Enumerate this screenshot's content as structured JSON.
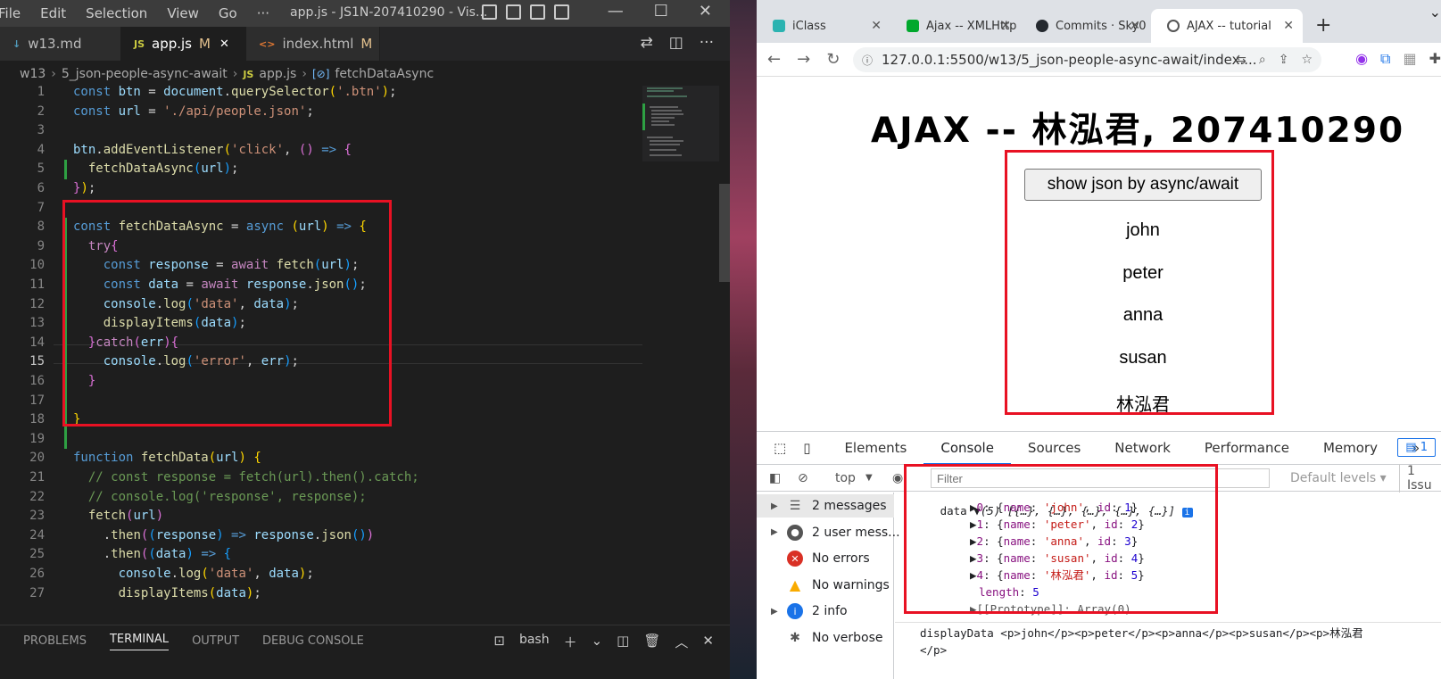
{
  "vscode": {
    "menu": [
      "File",
      "Edit",
      "Selection",
      "View",
      "Go",
      "···"
    ],
    "window_title": "app.js - JS1N-207410290 - Vis...",
    "tabs": [
      {
        "icon": "",
        "label": "w13.md"
      },
      {
        "icon": "JS",
        "label": "app.js",
        "mod": "M"
      },
      {
        "icon": "<>",
        "label": "index.html",
        "mod": "M"
      }
    ],
    "breadcrumb": [
      "w13",
      "5_json-people-async-await",
      "app.js",
      "fetchDataAsync"
    ],
    "panel_tabs": [
      "PROBLEMS",
      "TERMINAL",
      "OUTPUT",
      "DEBUG CONSOLE"
    ],
    "terminal_shell": "bash",
    "current_line": 15
  },
  "code": [
    [
      [
        "kw",
        "const "
      ],
      [
        "var",
        "btn"
      ],
      [
        "pl",
        " = "
      ],
      [
        "var",
        "document"
      ],
      [
        "pl",
        "."
      ],
      [
        "fn",
        "querySelector"
      ],
      [
        "br1",
        "("
      ],
      [
        "str",
        "'.btn'"
      ],
      [
        "br1",
        ")"
      ],
      [
        "pl",
        ";"
      ]
    ],
    [
      [
        "kw",
        "const "
      ],
      [
        "var",
        "url"
      ],
      [
        "pl",
        " = "
      ],
      [
        "str",
        "'./api/people.json'"
      ],
      [
        "pl",
        ";"
      ]
    ],
    [],
    [
      [
        "var",
        "btn"
      ],
      [
        "pl",
        "."
      ],
      [
        "fn",
        "addEventListener"
      ],
      [
        "br1",
        "("
      ],
      [
        "str",
        "'click'"
      ],
      [
        "pl",
        ", "
      ],
      [
        "br2",
        "()"
      ],
      [
        "kw",
        " => "
      ],
      [
        "br2",
        "{"
      ]
    ],
    [
      [
        "pl",
        "  "
      ],
      [
        "fn",
        "fetchDataAsync"
      ],
      [
        "br3",
        "("
      ],
      [
        "var",
        "url"
      ],
      [
        "br3",
        ")"
      ],
      [
        "pl",
        ";"
      ]
    ],
    [
      [
        "br2",
        "}"
      ],
      [
        "br1",
        ")"
      ],
      [
        "pl",
        ";"
      ]
    ],
    [],
    [
      [
        "kw",
        "const "
      ],
      [
        "fn",
        "fetchDataAsync"
      ],
      [
        "pl",
        " = "
      ],
      [
        "kw",
        "async "
      ],
      [
        "br1",
        "("
      ],
      [
        "var",
        "url"
      ],
      [
        "br1",
        ")"
      ],
      [
        "kw",
        " => "
      ],
      [
        "br1",
        "{"
      ]
    ],
    [
      [
        "pl",
        "  "
      ],
      [
        "ctl",
        "try"
      ],
      [
        "br2",
        "{"
      ]
    ],
    [
      [
        "pl",
        "    "
      ],
      [
        "kw",
        "const "
      ],
      [
        "var",
        "response"
      ],
      [
        "pl",
        " = "
      ],
      [
        "ctl",
        "await "
      ],
      [
        "fn",
        "fetch"
      ],
      [
        "br3",
        "("
      ],
      [
        "var",
        "url"
      ],
      [
        "br3",
        ")"
      ],
      [
        "pl",
        ";"
      ]
    ],
    [
      [
        "pl",
        "    "
      ],
      [
        "kw",
        "const "
      ],
      [
        "var",
        "data"
      ],
      [
        "pl",
        " = "
      ],
      [
        "ctl",
        "await "
      ],
      [
        "var",
        "response"
      ],
      [
        "pl",
        "."
      ],
      [
        "fn",
        "json"
      ],
      [
        "br3",
        "()"
      ],
      [
        "pl",
        ";"
      ]
    ],
    [
      [
        "pl",
        "    "
      ],
      [
        "var",
        "console"
      ],
      [
        "pl",
        "."
      ],
      [
        "fn",
        "log"
      ],
      [
        "br3",
        "("
      ],
      [
        "str",
        "'data'"
      ],
      [
        "pl",
        ", "
      ],
      [
        "var",
        "data"
      ],
      [
        "br3",
        ")"
      ],
      [
        "pl",
        ";"
      ]
    ],
    [
      [
        "pl",
        "    "
      ],
      [
        "fn",
        "displayItems"
      ],
      [
        "br3",
        "("
      ],
      [
        "var",
        "data"
      ],
      [
        "br3",
        ")"
      ],
      [
        "pl",
        ";"
      ]
    ],
    [
      [
        "pl",
        "  "
      ],
      [
        "br2",
        "}"
      ],
      [
        "ctl",
        "catch"
      ],
      [
        "br2",
        "("
      ],
      [
        "var",
        "err"
      ],
      [
        "br2",
        ")"
      ],
      [
        "br2",
        "{"
      ]
    ],
    [
      [
        "pl",
        "    "
      ],
      [
        "var",
        "console"
      ],
      [
        "pl",
        "."
      ],
      [
        "fn",
        "log"
      ],
      [
        "br3",
        "("
      ],
      [
        "str",
        "'error'"
      ],
      [
        "pl",
        ", "
      ],
      [
        "var",
        "err"
      ],
      [
        "br3",
        ")"
      ],
      [
        "pl",
        ";"
      ]
    ],
    [
      [
        "pl",
        "  "
      ],
      [
        "br2",
        "}"
      ]
    ],
    [],
    [
      [
        "br1",
        "}"
      ]
    ],
    [],
    [
      [
        "kw",
        "function "
      ],
      [
        "fn",
        "fetchData"
      ],
      [
        "br1",
        "("
      ],
      [
        "var",
        "url"
      ],
      [
        "br1",
        ")"
      ],
      [
        "pl",
        " "
      ],
      [
        "br1",
        "{"
      ]
    ],
    [
      [
        "cm",
        "  // const response = fetch(url).then().catch;"
      ]
    ],
    [
      [
        "cm",
        "  // console.log('response', response);"
      ]
    ],
    [
      [
        "pl",
        "  "
      ],
      [
        "fn",
        "fetch"
      ],
      [
        "br2",
        "("
      ],
      [
        "var",
        "url"
      ],
      [
        "br2",
        ")"
      ]
    ],
    [
      [
        "pl",
        "    ."
      ],
      [
        "fn",
        "then"
      ],
      [
        "br2",
        "("
      ],
      [
        "br3",
        "("
      ],
      [
        "var",
        "response"
      ],
      [
        "br3",
        ")"
      ],
      [
        "kw",
        " => "
      ],
      [
        "var",
        "response"
      ],
      [
        "pl",
        "."
      ],
      [
        "fn",
        "json"
      ],
      [
        "br3",
        "()"
      ],
      [
        "br2",
        ")"
      ]
    ],
    [
      [
        "pl",
        "    ."
      ],
      [
        "fn",
        "then"
      ],
      [
        "br2",
        "("
      ],
      [
        "br3",
        "("
      ],
      [
        "var",
        "data"
      ],
      [
        "br3",
        ")"
      ],
      [
        "kw",
        " => "
      ],
      [
        "br3",
        "{"
      ]
    ],
    [
      [
        "pl",
        "      "
      ],
      [
        "var",
        "console"
      ],
      [
        "pl",
        "."
      ],
      [
        "fn",
        "log"
      ],
      [
        "br1",
        "("
      ],
      [
        "str",
        "'data'"
      ],
      [
        "pl",
        ", "
      ],
      [
        "var",
        "data"
      ],
      [
        "br1",
        ")"
      ],
      [
        "pl",
        ";"
      ]
    ],
    [
      [
        "pl",
        "      "
      ],
      [
        "fn",
        "displayItems"
      ],
      [
        "br1",
        "("
      ],
      [
        "var",
        "data"
      ],
      [
        "br1",
        ")"
      ],
      [
        "pl",
        ";"
      ]
    ],
    [
      [
        "pl",
        "    "
      ],
      [
        "br3",
        "}"
      ],
      [
        "br2",
        ")"
      ]
    ]
  ],
  "chrome": {
    "tabs": [
      "iClass",
      "Ajax -- XMLHttp",
      "Commits · Sky0",
      "AJAX -- tutorial"
    ],
    "url": "127.0.0.1:5500/w13/5_json-people-async-await/index....",
    "page_title": "AJAX -- 林泓君, 207410290",
    "button": "show json by async/await",
    "people": [
      "john",
      "peter",
      "anna",
      "susan",
      "林泓君"
    ]
  },
  "devtools": {
    "tabs": [
      "Elements",
      "Console",
      "Sources",
      "Network",
      "Performance",
      "Memory"
    ],
    "active_tab": "Console",
    "issues_count": "1",
    "context": "top",
    "filter_placeholder": "Filter",
    "levels": "Default levels ▾",
    "issues_label": "1 Issu",
    "sidebar": [
      {
        "label": "2 messages",
        "icon": "list-icon",
        "color": "#555"
      },
      {
        "label": "2 user mess...",
        "icon": "user-icon",
        "color": "#555"
      },
      {
        "label": "No errors",
        "icon": "error-icon",
        "color": "#d93025"
      },
      {
        "label": "No warnings",
        "icon": "warning-icon",
        "color": "#f9ab00"
      },
      {
        "label": "2 info",
        "icon": "info-icon",
        "color": "#1a73e8"
      },
      {
        "label": "No verbose",
        "icon": "bug-icon",
        "color": "#555"
      }
    ],
    "log_label": "data",
    "array_summary": "(5) [{…}, {…}, {…}, {…}, {…}]",
    "entries": [
      {
        "index": "0",
        "name": "'john'",
        "id": "1"
      },
      {
        "index": "1",
        "name": "'peter'",
        "id": "2"
      },
      {
        "index": "2",
        "name": "'anna'",
        "id": "3"
      },
      {
        "index": "3",
        "name": "'susan'",
        "id": "4"
      },
      {
        "index": "4",
        "name": "'林泓君'",
        "id": "5"
      }
    ],
    "length_key": "length",
    "length_val": "5",
    "proto": "[[Prototype]]: Array(0)",
    "display_line1": "displayData <p>john</p><p>peter</p><p>anna</p><p>susan</p><p>林泓君",
    "display_line2": "</p>"
  }
}
